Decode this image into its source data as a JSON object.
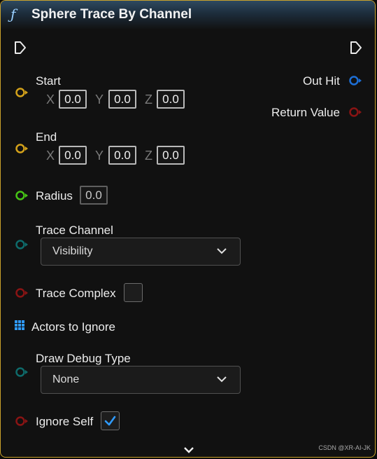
{
  "node": {
    "title": "Sphere Trace By Channel",
    "function_icon": "function-icon",
    "inputs": {
      "start": {
        "label": "Start",
        "x_axis": "X",
        "y_axis": "Y",
        "z_axis": "Z",
        "x": "0.0",
        "y": "0.0",
        "z": "0.0"
      },
      "end": {
        "label": "End",
        "x_axis": "X",
        "y_axis": "Y",
        "z_axis": "Z",
        "x": "0.0",
        "y": "0.0",
        "z": "0.0"
      },
      "radius": {
        "label": "Radius",
        "value": "0.0"
      },
      "trace_channel": {
        "label": "Trace Channel",
        "selected": "Visibility"
      },
      "trace_complex": {
        "label": "Trace Complex",
        "checked": false
      },
      "actors_to_ignore": {
        "label": "Actors to Ignore"
      },
      "draw_debug_type": {
        "label": "Draw Debug Type",
        "selected": "None"
      },
      "ignore_self": {
        "label": "Ignore Self",
        "checked": true
      }
    },
    "outputs": {
      "out_hit": {
        "label": "Out Hit"
      },
      "return_value": {
        "label": "Return Value"
      }
    }
  },
  "colors": {
    "border": "#caa22b",
    "vector_pin": "#d4a21a",
    "float_pin": "#46c416",
    "enum_pin": "#0e6b6b",
    "bool_pin": "#8a1414",
    "struct_pin": "#1d6fd6",
    "array_pin": "#2f9bff",
    "check": "#2f9bff"
  },
  "watermark": "CSDN @XR-AI-JK"
}
